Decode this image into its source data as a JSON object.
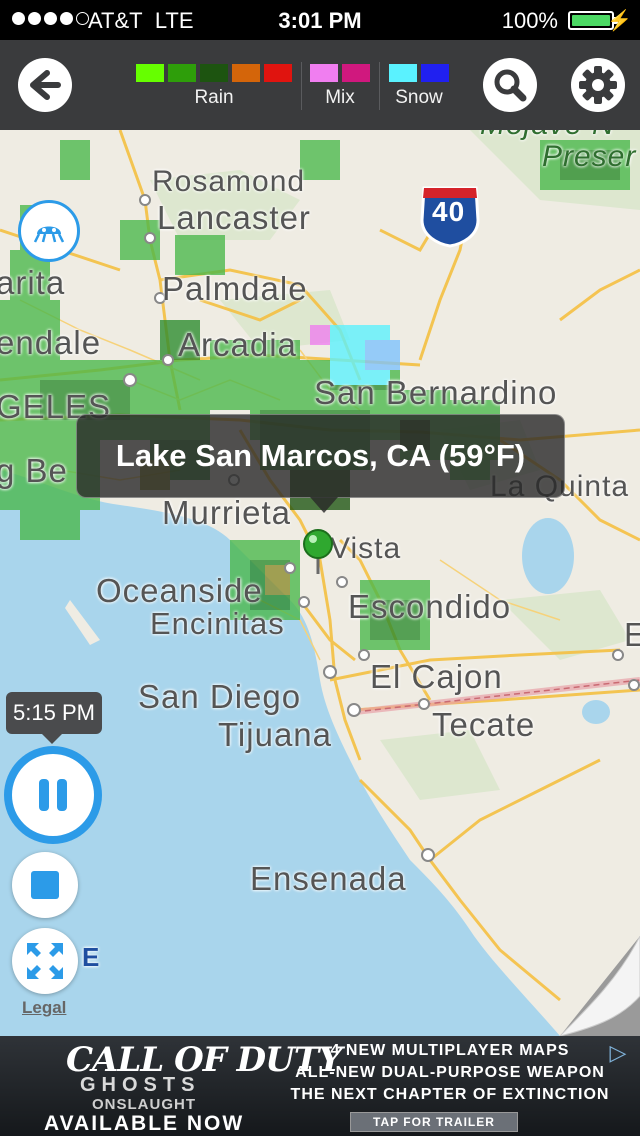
{
  "status_bar": {
    "carrier": "AT&T",
    "network": "LTE",
    "time": "3:01 PM",
    "battery": "100%",
    "signal_bars": 4,
    "signal_total": 5
  },
  "toolbar": {
    "back_icon": "back-arrow-icon",
    "search_icon": "search-icon",
    "settings_icon": "gear-icon",
    "legend": [
      {
        "label": "Rain",
        "colors": [
          "#66ff00",
          "#2e9e0a",
          "#1d5410",
          "#d4650a",
          "#e0140f"
        ]
      },
      {
        "label": "Mix",
        "colors": [
          "#f07ef0",
          "#d0187e"
        ]
      },
      {
        "label": "Snow",
        "colors": [
          "#5af2ff",
          "#2020f0"
        ]
      }
    ]
  },
  "map": {
    "cities": {
      "rosamond": "Rosamond",
      "lancaster": "Lancaster",
      "palmdale": "Palmdale",
      "arcadia": "Arcadia",
      "san_bernardino": "San Bernardino",
      "la_quinta": "La Quinta",
      "murrieta": "Murrieta",
      "vista": "Vista",
      "oceanside": "Oceanside",
      "encinitas": "Encinitas",
      "escondido": "Escondido",
      "el_cajon": "El Cajon",
      "san_diego": "San Diego",
      "tecate": "Tecate",
      "tijuana": "Tijuana",
      "ensenada": "Ensenada",
      "edge_arita": "arita",
      "edge_endale": "endale",
      "edge_geles": "GELES",
      "edge_gbe": "g Be",
      "edge_e": "E",
      "edge_e2": "E",
      "mojave": "Mojave N",
      "preserve": "Preser"
    },
    "highway_shield": "40",
    "callout": "Lake San Marcos, CA (59°F)"
  },
  "controls": {
    "time_badge": "5:15 PM",
    "pause_icon": "pause-icon",
    "stop_icon": "stop-icon",
    "expand_icon": "expand-icon",
    "radar_icon": "radar-layer-icon",
    "legal": "Legal"
  },
  "ad": {
    "brand_line1": "CALL OF DUTY",
    "brand_line2": "GHOSTS",
    "brand_line3": "ONSLAUGHT",
    "brand_line4": "AVAILABLE NOW",
    "line1": "4 NEW MULTIPLAYER MAPS",
    "line2": "ALL-NEW DUAL-PURPOSE WEAPON",
    "line3": "THE NEXT CHAPTER OF EXTINCTION",
    "cta": "TAP FOR TRAILER"
  }
}
